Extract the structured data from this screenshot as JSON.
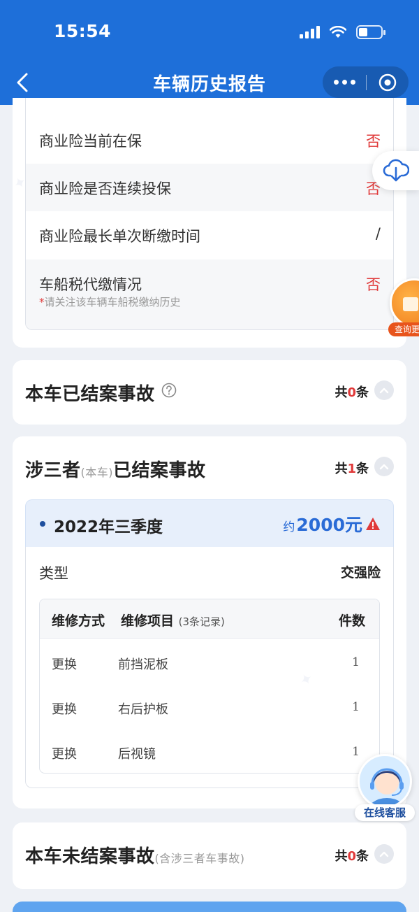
{
  "status_bar": {
    "time": "15:54"
  },
  "nav": {
    "title": "车辆历史报告"
  },
  "insurance": {
    "rows": [
      {
        "label": "商业险当前在保",
        "value": "否"
      },
      {
        "label": "商业险是否连续投保",
        "value": "否"
      },
      {
        "label": "商业险最长单次断缴时间",
        "value": "/"
      },
      {
        "label": "车船税代缴情况",
        "value": "否",
        "note": "请关注该车辆车船税缴纳历史"
      }
    ]
  },
  "closed_accidents": {
    "title": "本车已结案事故",
    "count_prefix": "共",
    "count": "0",
    "count_suffix": "条"
  },
  "third_party": {
    "title": "涉三者",
    "title_sub": "(本车)",
    "title_suffix": "已结案事故",
    "count_prefix": "共",
    "count": "1",
    "count_suffix": "条",
    "quarter": "2022年三季度",
    "amount_prefix": "约",
    "amount": "2000元",
    "type_label": "类型",
    "type_value": "交强险",
    "table": {
      "col_method": "维修方式",
      "col_item": "维修项目",
      "col_item_note": "(3条记录)",
      "col_qty": "件数",
      "rows": [
        {
          "method": "更换",
          "item": "前挡泥板",
          "qty": "1"
        },
        {
          "method": "更换",
          "item": "右后护板",
          "qty": "1"
        },
        {
          "method": "更换",
          "item": "后视镜",
          "qty": "1"
        }
      ]
    }
  },
  "open_accidents": {
    "title": "本车未结案事故",
    "title_sub": "(含涉三者车事故)",
    "count_prefix": "共",
    "count": "0",
    "count_suffix": "条"
  },
  "floating": {
    "query_label": "查询更多",
    "service_label": "在线客服"
  },
  "colors": {
    "brand_blue": "#1e6fd9",
    "alert_red": "#e03a3a",
    "amount_blue": "#2a6bd6"
  }
}
